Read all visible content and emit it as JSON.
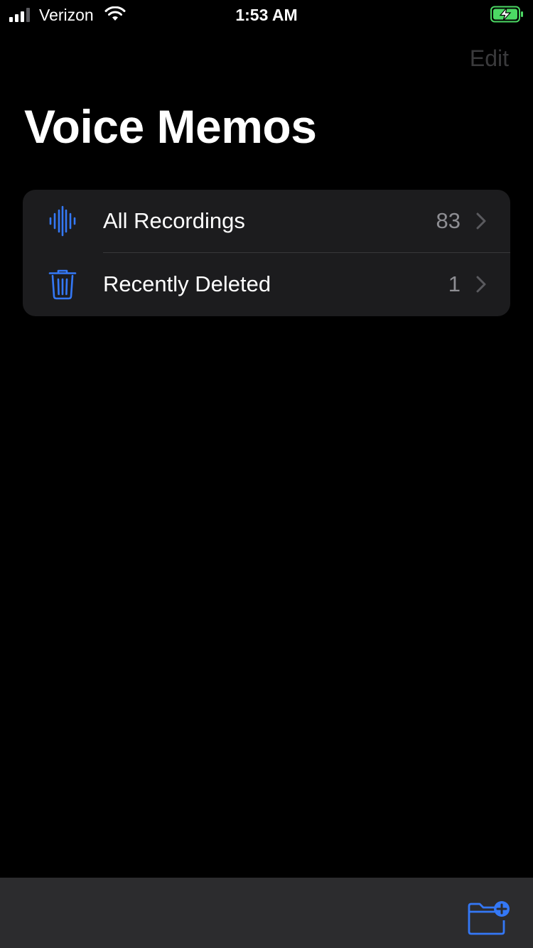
{
  "status_bar": {
    "carrier": "Verizon",
    "time": "1:53 AM",
    "signal_icon": "cellular-signal-icon",
    "wifi_icon": "wifi-icon",
    "battery_icon": "battery-charging-icon"
  },
  "header": {
    "edit_label": "Edit",
    "title": "Voice Memos"
  },
  "folders": [
    {
      "icon": "waveform-icon",
      "label": "All Recordings",
      "count": "83"
    },
    {
      "icon": "trash-icon",
      "label": "Recently Deleted",
      "count": "1"
    }
  ],
  "toolbar": {
    "new_folder_icon": "new-folder-icon"
  },
  "colors": {
    "accent": "#3478f6",
    "background": "#000000",
    "list_background": "#1c1c1e",
    "toolbar_background": "#2c2c2e",
    "secondary_text": "#8e8e93",
    "disabled_text": "#3a3a3c",
    "battery_green": "#4cd964"
  }
}
